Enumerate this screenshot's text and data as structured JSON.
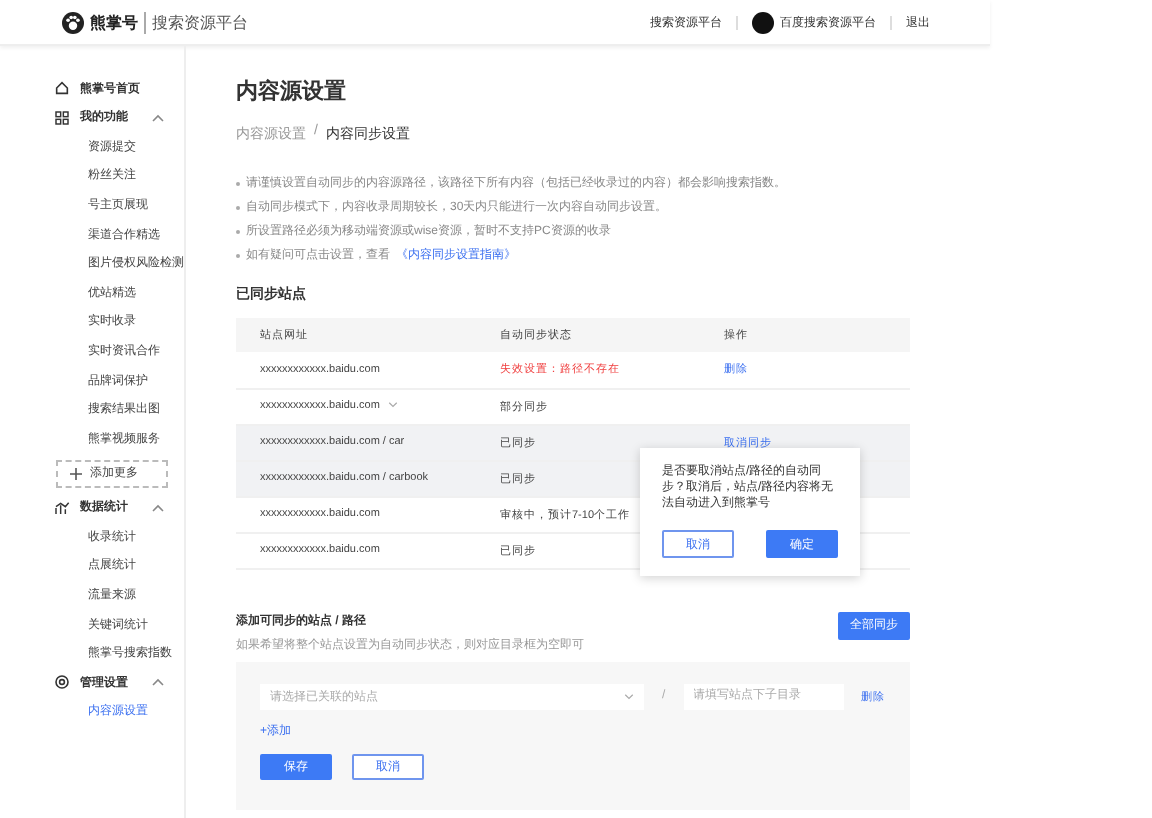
{
  "header": {
    "logo": "熊掌号",
    "platform": "搜索资源平台",
    "link": "搜索资源平台",
    "account": "百度搜索资源平台",
    "logout": "退出"
  },
  "sidebar": [
    {
      "kind": "link",
      "label": "熊掌号首页",
      "selected": false
    },
    {
      "kind": "group",
      "label": "我的功能",
      "expanded": true,
      "children": [
        {
          "label": "资源提交",
          "selected": false
        },
        {
          "label": "粉丝关注",
          "selected": false
        },
        {
          "label": "号主页展现",
          "selected": false
        },
        {
          "label": "渠道合作精选",
          "selected": false
        },
        {
          "label": "图片侵权风险检测",
          "selected": false
        },
        {
          "label": "优站精选",
          "selected": false
        },
        {
          "label": "实时收录",
          "selected": false
        },
        {
          "label": "实时资讯合作",
          "selected": false
        },
        {
          "label": "品牌词保护",
          "selected": false
        },
        {
          "label": "搜索结果出图",
          "selected": false
        },
        {
          "label": "熊掌视频服务",
          "selected": false
        }
      ]
    },
    {
      "kind": "add",
      "label": "添加更多"
    },
    {
      "kind": "group",
      "label": "数据统计",
      "expanded": true,
      "children": [
        {
          "label": "收录统计",
          "selected": false
        },
        {
          "label": "点展统计",
          "selected": false
        },
        {
          "label": "流量来源",
          "selected": false
        },
        {
          "label": "关键词统计",
          "selected": false
        },
        {
          "label": "熊掌号搜索指数",
          "selected": false
        }
      ]
    },
    {
      "kind": "group",
      "label": "管理设置",
      "expanded": true,
      "children": [
        {
          "label": "内容源设置",
          "selected": true
        }
      ]
    }
  ],
  "page": {
    "title": "内容源设置",
    "breadcrumb_separator": "/",
    "breadcrumb": [
      {
        "label": "内容源设置",
        "current": false
      },
      {
        "label": "内容同步设置",
        "current": true
      }
    ],
    "notes": [
      {
        "text": "请谨慎设置自动同步的内容源路径，该路径下所有内容（包括已经收录过的内容）都会影响搜索指数。"
      },
      {
        "text": "自动同步模式下，内容收录周期较长，30天内只能进行一次内容自动同步设置。"
      },
      {
        "text": "所设置路径必须为移动端资源或wise资源，暂时不支持PC资源的收录"
      },
      {
        "text": "如有疑问可点击设置，查看",
        "link": "《内容同步设置指南》"
      }
    ]
  },
  "synced": {
    "title": "已同步站点",
    "columns": [
      "站点网址",
      "自动同步状态",
      "操作"
    ],
    "rows": [
      {
        "url": "xxxxxxxxxxxx.baidu.com",
        "dropdown": false,
        "status": "失效设置：路径不存在",
        "status_error": true,
        "action": "删除",
        "highlighted": false
      },
      {
        "url": "xxxxxxxxxxxx.baidu.com",
        "dropdown": true,
        "status": "部分同步",
        "status_error": false,
        "highlighted": false
      },
      {
        "url": "xxxxxxxxxxxx.baidu.com / car",
        "dropdown": false,
        "status": "已同步",
        "status_error": false,
        "action": "取消同步",
        "highlighted": true
      },
      {
        "url": "xxxxxxxxxxxx.baidu.com / carbook",
        "dropdown": false,
        "status": "已同步",
        "status_error": false,
        "highlighted": true
      },
      {
        "url": "xxxxxxxxxxxx.baidu.com",
        "dropdown": false,
        "status": "审核中，预计7-10个工作",
        "status_error": false,
        "highlighted": false
      },
      {
        "url": "xxxxxxxxxxxx.baidu.com",
        "dropdown": false,
        "status": "已同步",
        "status_error": false,
        "highlighted": false
      }
    ]
  },
  "popover": {
    "message": "是否要取消站点/路径的自动同步？取消后，站点/路径内容将无法自动进入到熊掌号",
    "cancel": "取消",
    "confirm": "确定"
  },
  "add_section": {
    "title": "添加可同步的站点 / 路径",
    "hint": "如果希望将整个站点设置为自动同步状态，则对应目录框为空即可",
    "sync_all": "全部同步",
    "site_placeholder": "请选择已关联的站点",
    "separator": "/",
    "path_placeholder": "请填写站点下子目录",
    "delete": "删除",
    "add": "+添加",
    "save": "保存",
    "cancel": "取消"
  }
}
